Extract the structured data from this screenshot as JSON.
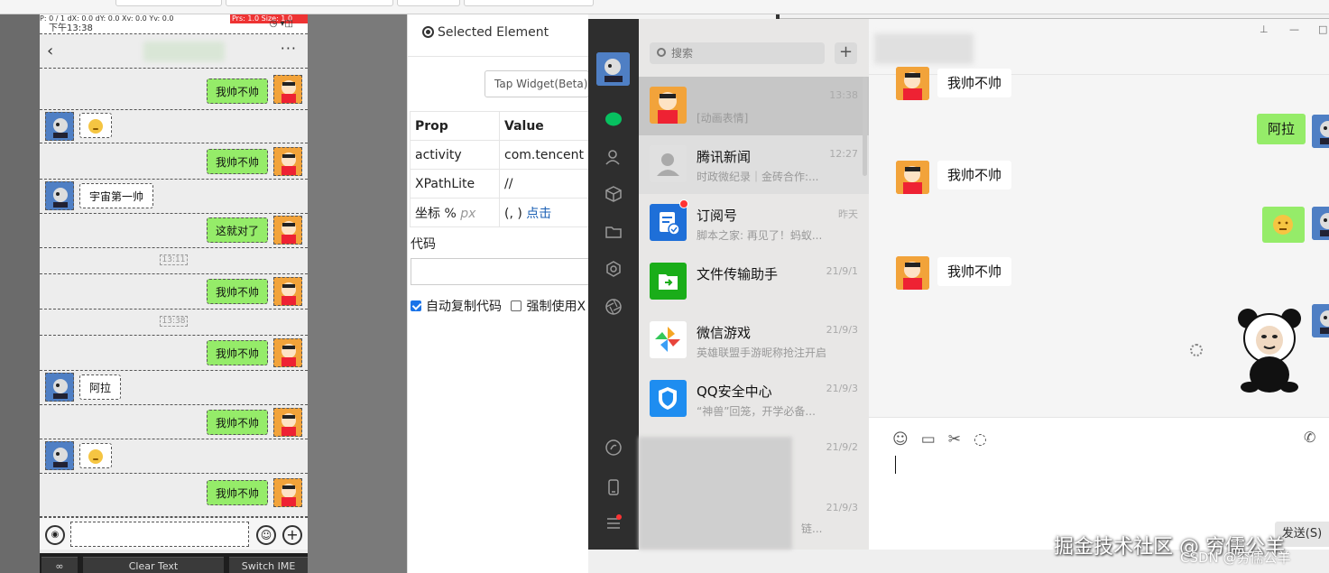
{
  "phone": {
    "status_time": "下午13:38",
    "debug_left": "P: 0 / 1    dX: 0.0    dY: 0.0    Xv: 0.0    Yv: 0.0",
    "debug_red": "Prs: 1.0  Size: 1.0",
    "messages": [
      {
        "side": "right",
        "text": "我帅不帅"
      },
      {
        "side": "left",
        "text": ""
      },
      {
        "side": "right",
        "text": "我帅不帅"
      },
      {
        "side": "left",
        "text": "宇宙第一帅"
      },
      {
        "side": "right",
        "text": "这就对了"
      },
      {
        "side": "time",
        "text": "13:11"
      },
      {
        "side": "right",
        "text": "我帅不帅"
      },
      {
        "side": "time",
        "text": "13:38"
      },
      {
        "side": "right",
        "text": "我帅不帅"
      },
      {
        "side": "left",
        "text": "阿拉"
      },
      {
        "side": "right",
        "text": "我帅不帅"
      },
      {
        "side": "left",
        "text": ""
      },
      {
        "side": "right",
        "text": "我帅不帅"
      }
    ],
    "bottom_buttons": [
      "Clear Text",
      "Switch IME"
    ]
  },
  "inspector": {
    "title": "Selected Element",
    "tap_button": "Tap Widget(Beta)",
    "table_head": [
      "Prop",
      "Value"
    ],
    "rows": [
      {
        "prop": "activity",
        "value": "com.tencent"
      },
      {
        "prop": "XPathLite",
        "value": "//"
      },
      {
        "prop": "坐标 %",
        "unit": "px",
        "value": "(, )",
        "link": "点击"
      }
    ],
    "code_label": "代码",
    "chk_auto": "自动复制代码",
    "chk_force": "强制使用X"
  },
  "wechat": {
    "search_placeholder": "搜索",
    "add": "+",
    "chats": [
      {
        "name": "",
        "sub": "[动画表情]",
        "time": "13:38"
      },
      {
        "name": "腾讯新闻",
        "sub": "时政微纪录｜金砖合作:...",
        "time": "12:27"
      },
      {
        "name": "订阅号",
        "sub": "脚本之家: 再见了！蚂蚁...",
        "time": "昨天"
      },
      {
        "name": "文件传输助手",
        "sub": "",
        "time": "21/9/1"
      },
      {
        "name": "微信游戏",
        "sub": "英雄联盟手游昵称抢注开启",
        "time": "21/9/3"
      },
      {
        "name": "QQ安全中心",
        "sub": "“神兽”回笼，开学必备...",
        "time": "21/9/3"
      },
      {
        "name": "",
        "sub": "",
        "time": "21/9/2"
      },
      {
        "name": "",
        "sub": "链...",
        "time": "21/9/3"
      }
    ],
    "conversation": [
      {
        "side": "left",
        "text": "我帅不帅"
      },
      {
        "side": "right",
        "text": "阿拉"
      },
      {
        "side": "left",
        "text": "我帅不帅"
      },
      {
        "side": "right",
        "text": ""
      },
      {
        "side": "left",
        "text": "我帅不帅"
      }
    ],
    "send": "发送(S)",
    "window_buttons": [
      "⊥",
      "—",
      "□"
    ]
  },
  "watermark": "掘金技术社区 @ 穷儒公羊",
  "watermark_small": "CSDN @穷儒公羊",
  "colors": {
    "wechat_green": "#95ec69",
    "nav_dark": "#2e2e2e",
    "accent_blue": "#1a5fb4"
  }
}
